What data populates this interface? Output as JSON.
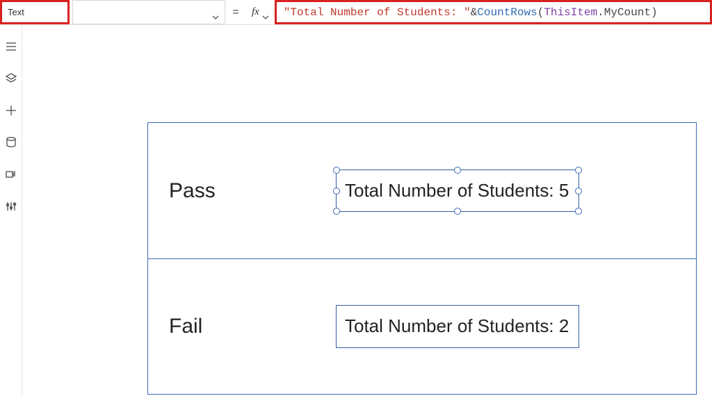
{
  "topbar": {
    "property": "Text",
    "equals": "=",
    "fx": "fx",
    "formula": {
      "string_part": "\"Total Number of Students: \"",
      "concat": " & ",
      "func": "CountRows",
      "open": "(",
      "obj": "ThisItem",
      "dot_member": ".MyCount",
      "close": ")"
    }
  },
  "gallery": {
    "rows": [
      {
        "status": "Pass",
        "countText": "Total Number of Students: 5",
        "selected": true
      },
      {
        "status": "Fail",
        "countText": "Total Number of Students: 2",
        "selected": false
      }
    ]
  }
}
